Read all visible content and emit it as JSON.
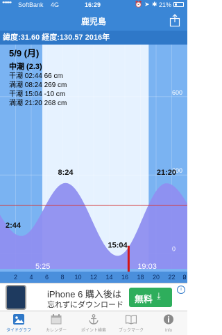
{
  "status": {
    "carrier": "SoftBank",
    "network": "4G",
    "time": "16:29",
    "battery": "21%"
  },
  "nav": {
    "title": "鹿児島"
  },
  "location": {
    "text": "緯度:31.60 経度:130.57  2016年"
  },
  "info": {
    "date": "5/9 (月)",
    "tide_name": "中潮 (2.3)",
    "events": [
      {
        "label": "干潮 02:44  66 cm"
      },
      {
        "label": "満潮 08:24 269 cm"
      },
      {
        "label": "干潮 15:04 -10 cm"
      },
      {
        "label": "満潮 21:20 268 cm"
      }
    ]
  },
  "chart_data": {
    "type": "area",
    "x_unit": "hour",
    "y_unit": "cm",
    "xlim": [
      0,
      24
    ],
    "ylim": [
      -60,
      800
    ],
    "x_ticks": [
      "2",
      "4",
      "6",
      "8",
      "10",
      "12",
      "14",
      "16",
      "18",
      "20",
      "22",
      "0",
      "2"
    ],
    "y_ticks": [
      "600",
      "300",
      "0"
    ],
    "extremes": [
      {
        "time": "2:44",
        "hour": 2.73,
        "value": 66,
        "kind": "low"
      },
      {
        "time": "8:24",
        "hour": 8.4,
        "value": 269,
        "kind": "high"
      },
      {
        "time": "15:04",
        "hour": 15.07,
        "value": -10,
        "kind": "low"
      },
      {
        "time": "21:20",
        "hour": 21.33,
        "value": 268,
        "kind": "high"
      }
    ],
    "sunrise": "5:25",
    "sunset": "19:03",
    "current_time_hour": 16.48,
    "colors": {
      "sky": "#7ab3f2",
      "daylight": "#e6f2ff",
      "tide_fill": "#8f8ff0",
      "now_line": "#d41515",
      "reference_line": "#d43a3a"
    }
  },
  "ad": {
    "line1": "iPhone 6 購入後は",
    "line2": "忘れずにダウンロード",
    "button": "無料"
  },
  "tabs": [
    {
      "label": "タイドグラフ",
      "icon": "photo-icon",
      "active": true
    },
    {
      "label": "カレンダー",
      "icon": "calendar-icon",
      "active": false
    },
    {
      "label": "ポイント検索",
      "icon": "anchor-icon",
      "active": false
    },
    {
      "label": "ブックマーク",
      "icon": "book-icon",
      "active": false
    },
    {
      "label": "Info",
      "icon": "info-icon",
      "active": false
    }
  ]
}
